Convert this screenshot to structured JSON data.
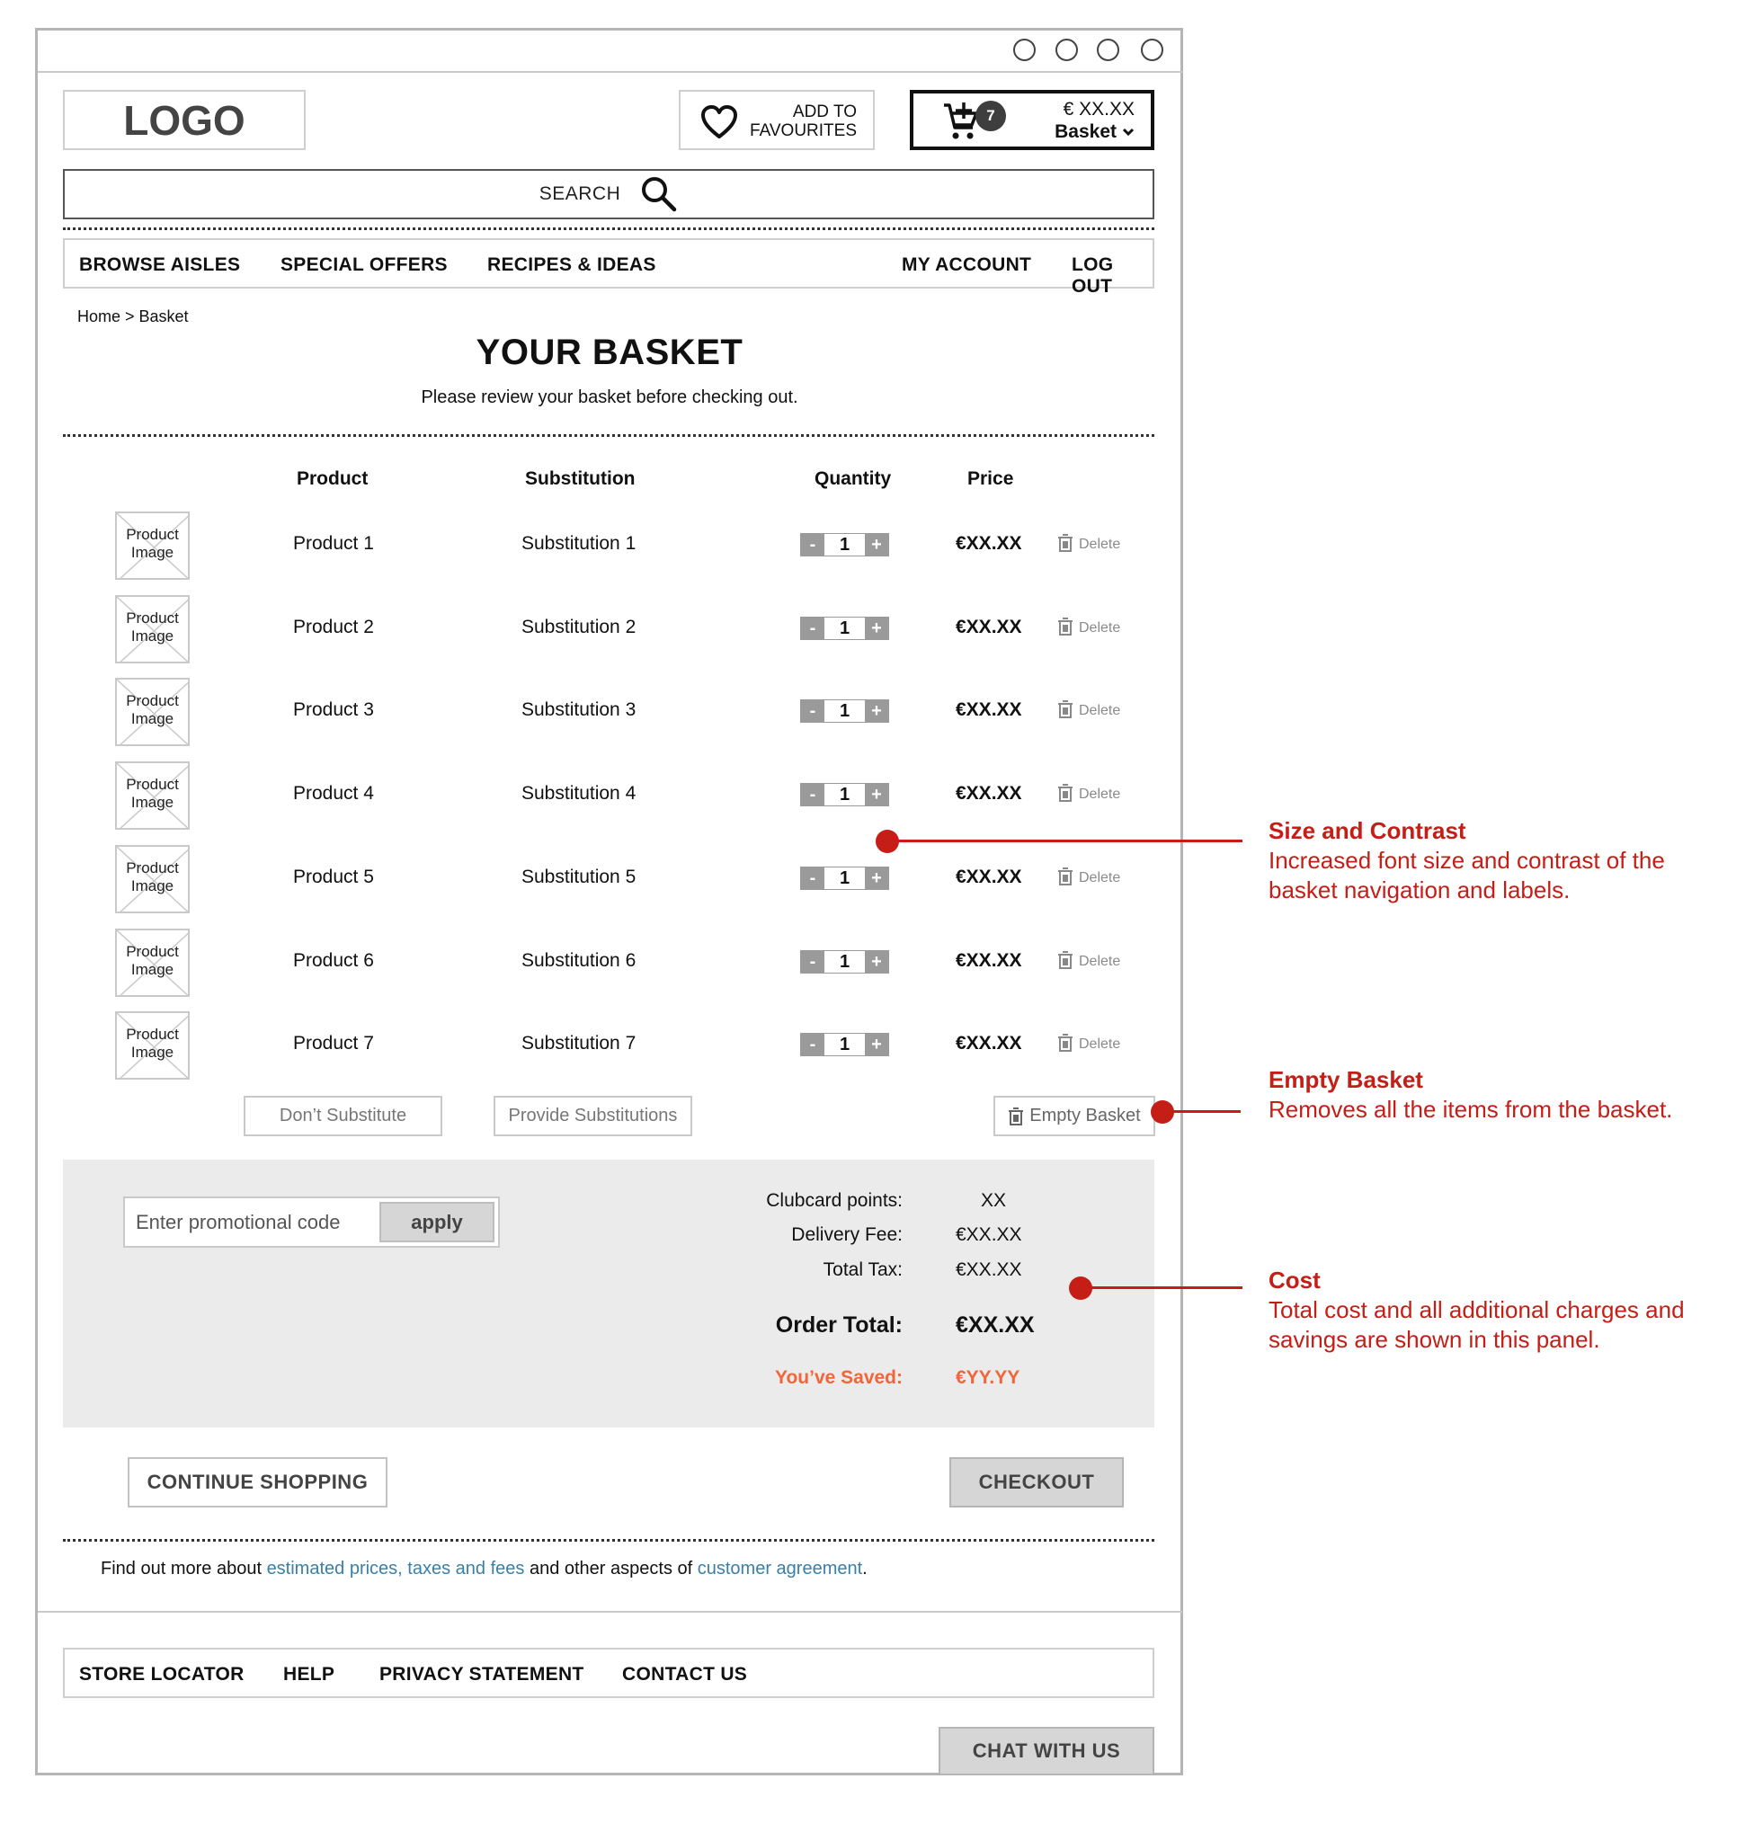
{
  "window": {
    "controls": [
      "window-control-1",
      "window-control-2",
      "window-control-3",
      "window-control-4"
    ]
  },
  "header": {
    "logo": "LOGO",
    "favourites": {
      "line1": "ADD TO",
      "line2": "FAVOURITES",
      "icon": "heart-icon"
    },
    "basket": {
      "count": "7",
      "amount": "€ XX.XX",
      "label": "Basket",
      "icon": "cart-icon"
    }
  },
  "search": {
    "label": "SEARCH",
    "icon": "search-icon"
  },
  "nav": {
    "left": [
      "BROWSE AISLES",
      "SPECIAL OFFERS",
      "RECIPES & IDEAS"
    ],
    "right": [
      "MY ACCOUNT",
      "LOG OUT"
    ]
  },
  "breadcrumb": "Home > Basket",
  "page": {
    "title": "YOUR BASKET",
    "subtitle": "Please review your basket before checking out."
  },
  "table": {
    "headers": {
      "product": "Product",
      "substitution": "Substitution",
      "quantity": "Quantity",
      "price": "Price"
    },
    "image_placeholder": {
      "line1": "Product",
      "line2": "Image"
    },
    "delete_label": "Delete",
    "rows": [
      {
        "product": "Product 1",
        "substitution": "Substitution 1",
        "qty": "1",
        "price": "€XX.XX"
      },
      {
        "product": "Product 2",
        "substitution": "Substitution 2",
        "qty": "1",
        "price": "€XX.XX"
      },
      {
        "product": "Product 3",
        "substitution": "Substitution 3",
        "qty": "1",
        "price": "€XX.XX"
      },
      {
        "product": "Product 4",
        "substitution": "Substitution 4",
        "qty": "1",
        "price": "€XX.XX"
      },
      {
        "product": "Product 5",
        "substitution": "Substitution 5",
        "qty": "1",
        "price": "€XX.XX"
      },
      {
        "product": "Product 6",
        "substitution": "Substitution 6",
        "qty": "1",
        "price": "€XX.XX"
      },
      {
        "product": "Product 7",
        "substitution": "Substitution 7",
        "qty": "1",
        "price": "€XX.XX"
      }
    ],
    "stepper": {
      "minus": "-",
      "plus": "+"
    }
  },
  "actions": {
    "dont_substitute": "Don’t Substitute",
    "provide_substitutions": "Provide Substitutions",
    "empty_basket": "Empty Basket"
  },
  "summary": {
    "promo_placeholder": "Enter promotional code",
    "apply": "apply",
    "clubcard_label": "Clubcard points:",
    "clubcard_value": "XX",
    "delivery_label": "Delivery Fee:",
    "delivery_value": "€XX.XX",
    "tax_label": "Total Tax:",
    "tax_value": "€XX.XX",
    "total_label": "Order Total:",
    "total_value": "€XX.XX",
    "saved_label": "You’ve Saved:",
    "saved_value": "€YY.YY",
    "saved_color": "#f0653a"
  },
  "buttons": {
    "continue": "CONTINUE SHOPPING",
    "checkout": "CHECKOUT"
  },
  "note": {
    "pre": "Find out more about ",
    "link1": "estimated prices, taxes and fees",
    "mid": " and other aspects of ",
    "link2": "customer agreement",
    "post": ".",
    "link_color": "#3b7fa5"
  },
  "footer": {
    "items": [
      "STORE LOCATOR",
      "HELP",
      "PRIVACY STATEMENT",
      "CONTACT US"
    ],
    "chat": "CHAT WITH US"
  },
  "annotations": [
    {
      "title": "Size and Contrast",
      "body": "Increased font size and contrast of the basket navigation and labels."
    },
    {
      "title": "Empty Basket",
      "body": "Removes all the items from the basket."
    },
    {
      "title": "Cost",
      "body": "Total cost and all additional charges and savings are shown in this panel."
    }
  ],
  "colors": {
    "annotation": "#c41e16",
    "panel": "#ebebec",
    "stepper": "#9a9a9a",
    "link": "#3b7fa5",
    "savings": "#f0653a"
  }
}
